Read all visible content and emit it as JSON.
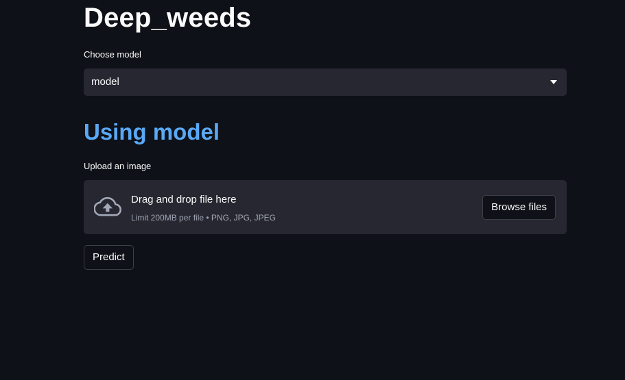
{
  "page": {
    "title": "Deep_weeds"
  },
  "model_select": {
    "label": "Choose model",
    "value": "model",
    "icon": "chevron-down-icon"
  },
  "subheader": "Using model",
  "uploader": {
    "label": "Upload an image",
    "drop_text": "Drag and drop file here",
    "limit_text": "Limit 200MB per file • PNG, JPG, JPEG",
    "browse_label": "Browse files",
    "icon": "cloud-upload-icon"
  },
  "predict_button": {
    "label": "Predict"
  },
  "colors": {
    "background": "#0e1117",
    "widget_background": "#262730",
    "text": "#fafafa",
    "subheader": "#5aa8f5",
    "muted_text": "#a3a8b8"
  }
}
